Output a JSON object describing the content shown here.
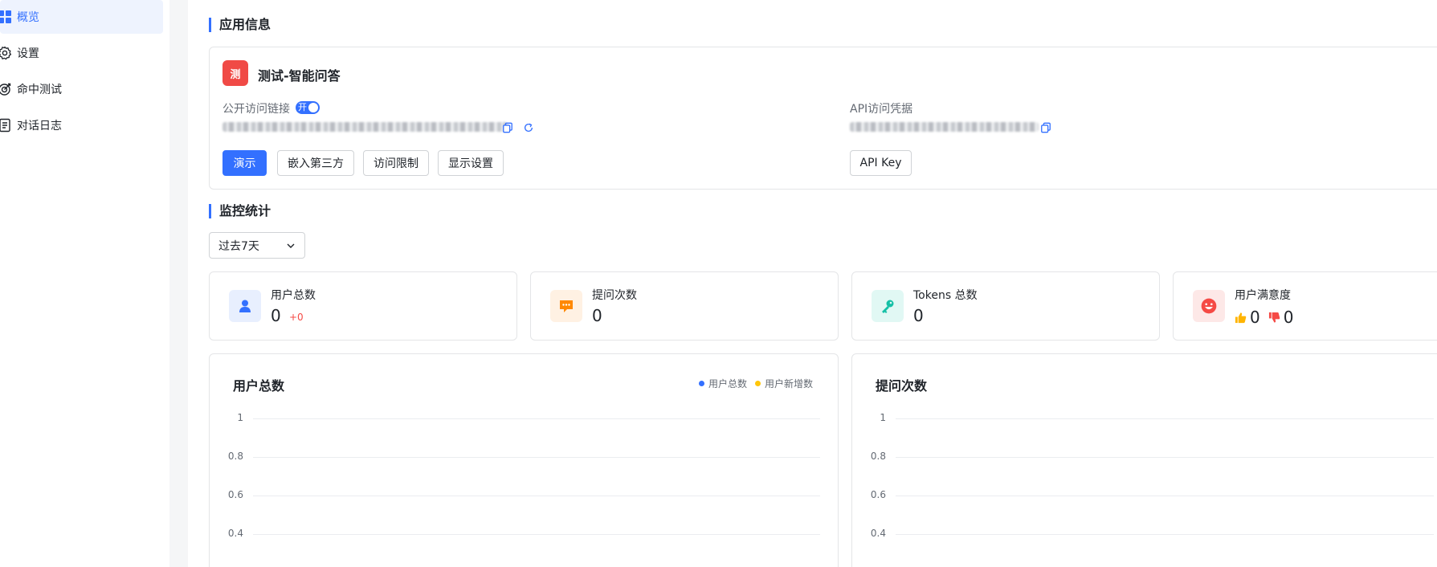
{
  "sidebar": {
    "items": [
      {
        "label": "概览",
        "icon": "grid-icon",
        "active": true
      },
      {
        "label": "设置",
        "icon": "gear-icon",
        "active": false
      },
      {
        "label": "命中测试",
        "icon": "target-icon",
        "active": false
      },
      {
        "label": "对话日志",
        "icon": "document-icon",
        "active": false
      }
    ]
  },
  "app_info": {
    "section_title": "应用信息",
    "badge": "测",
    "app_name": "测试-智能问答",
    "public_link_label": "公开访问链接",
    "toggle_label": "开",
    "api_label": "API访问凭据",
    "buttons": {
      "demo": "演示",
      "embed": "嵌入第三方",
      "access_limit": "访问限制",
      "display_settings": "显示设置",
      "api_key": "API Key"
    }
  },
  "monitor": {
    "section_title": "监控统计",
    "period": "过去7天",
    "stats": [
      {
        "label": "用户总数",
        "value": "0",
        "delta": "+0",
        "icon": "user-icon",
        "color": "#3370ff"
      },
      {
        "label": "提问次数",
        "value": "0",
        "icon": "chat-icon",
        "color": "#ff8800"
      },
      {
        "label": "Tokens 总数",
        "value": "0",
        "icon": "key-icon",
        "color": "#14c0a6"
      },
      {
        "label": "用户满意度",
        "like": "0",
        "dislike": "0",
        "icon": "smile-icon",
        "color": "#f54a45"
      }
    ]
  },
  "chart_data": [
    {
      "type": "line",
      "title": "用户总数",
      "series": [
        {
          "name": "用户总数",
          "color": "#3370ff",
          "values": []
        },
        {
          "name": "用户新增数",
          "color": "#ffc60a",
          "values": []
        }
      ],
      "yticks": [
        "1",
        "0.8",
        "0.6",
        "0.4"
      ],
      "ylim": [
        0,
        1
      ],
      "grid": true,
      "legend": "top-right"
    },
    {
      "type": "line",
      "title": "提问次数",
      "series": [],
      "yticks": [
        "1",
        "0.8",
        "0.6",
        "0.4"
      ],
      "ylim": [
        0,
        1
      ],
      "grid": true
    }
  ]
}
